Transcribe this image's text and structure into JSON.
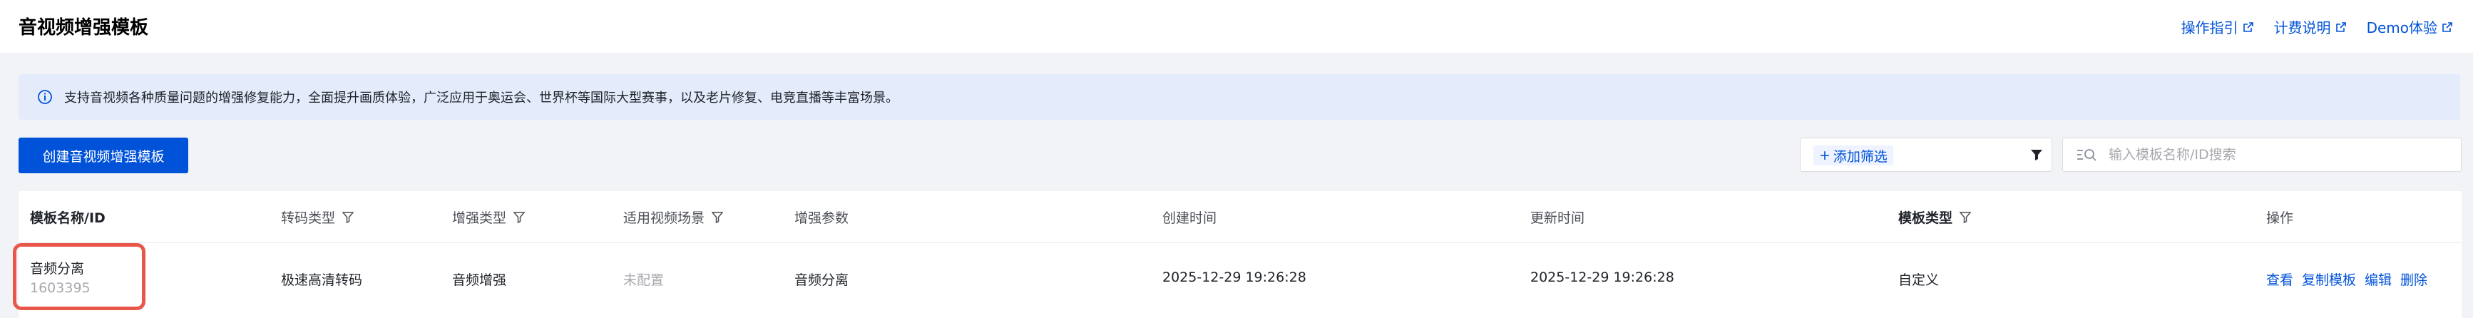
{
  "header": {
    "title": "音视频增强模板",
    "links": [
      "操作指引",
      "计费说明",
      "Demo体验"
    ]
  },
  "banner": {
    "text": "支持音视频各种质量问题的增强修复能力，全面提升画质体验，广泛应用于奥运会、世界杯等国际大型赛事，以及老片修复、电竞直播等丰富场景。"
  },
  "toolbar": {
    "create_label": "创建音视频增强模板",
    "add_filter_label": "添加筛选",
    "search_placeholder": "输入模板名称/ID搜索"
  },
  "table": {
    "columns": [
      "模板名称/ID",
      "转码类型",
      "增强类型",
      "适用视频场景",
      "增强参数",
      "创建时间",
      "更新时间",
      "模板类型",
      "操作"
    ],
    "rows": [
      {
        "name": "音频分离",
        "id": "1603395",
        "transcode_type": "极速高清转码",
        "enhance_type": "音频增强",
        "scene": "未配置",
        "params": "音频分离",
        "created": "2025-12-29 19:26:28",
        "updated": "2025-12-29 19:26:28",
        "template_type": "自定义",
        "actions": [
          "查看",
          "复制模板",
          "编辑",
          "删除"
        ]
      }
    ]
  },
  "colors": {
    "accent": "#0052d9",
    "banner_bg": "#e4ebfb",
    "highlight": "#e9564a",
    "page_bg": "#f2f3f7"
  }
}
